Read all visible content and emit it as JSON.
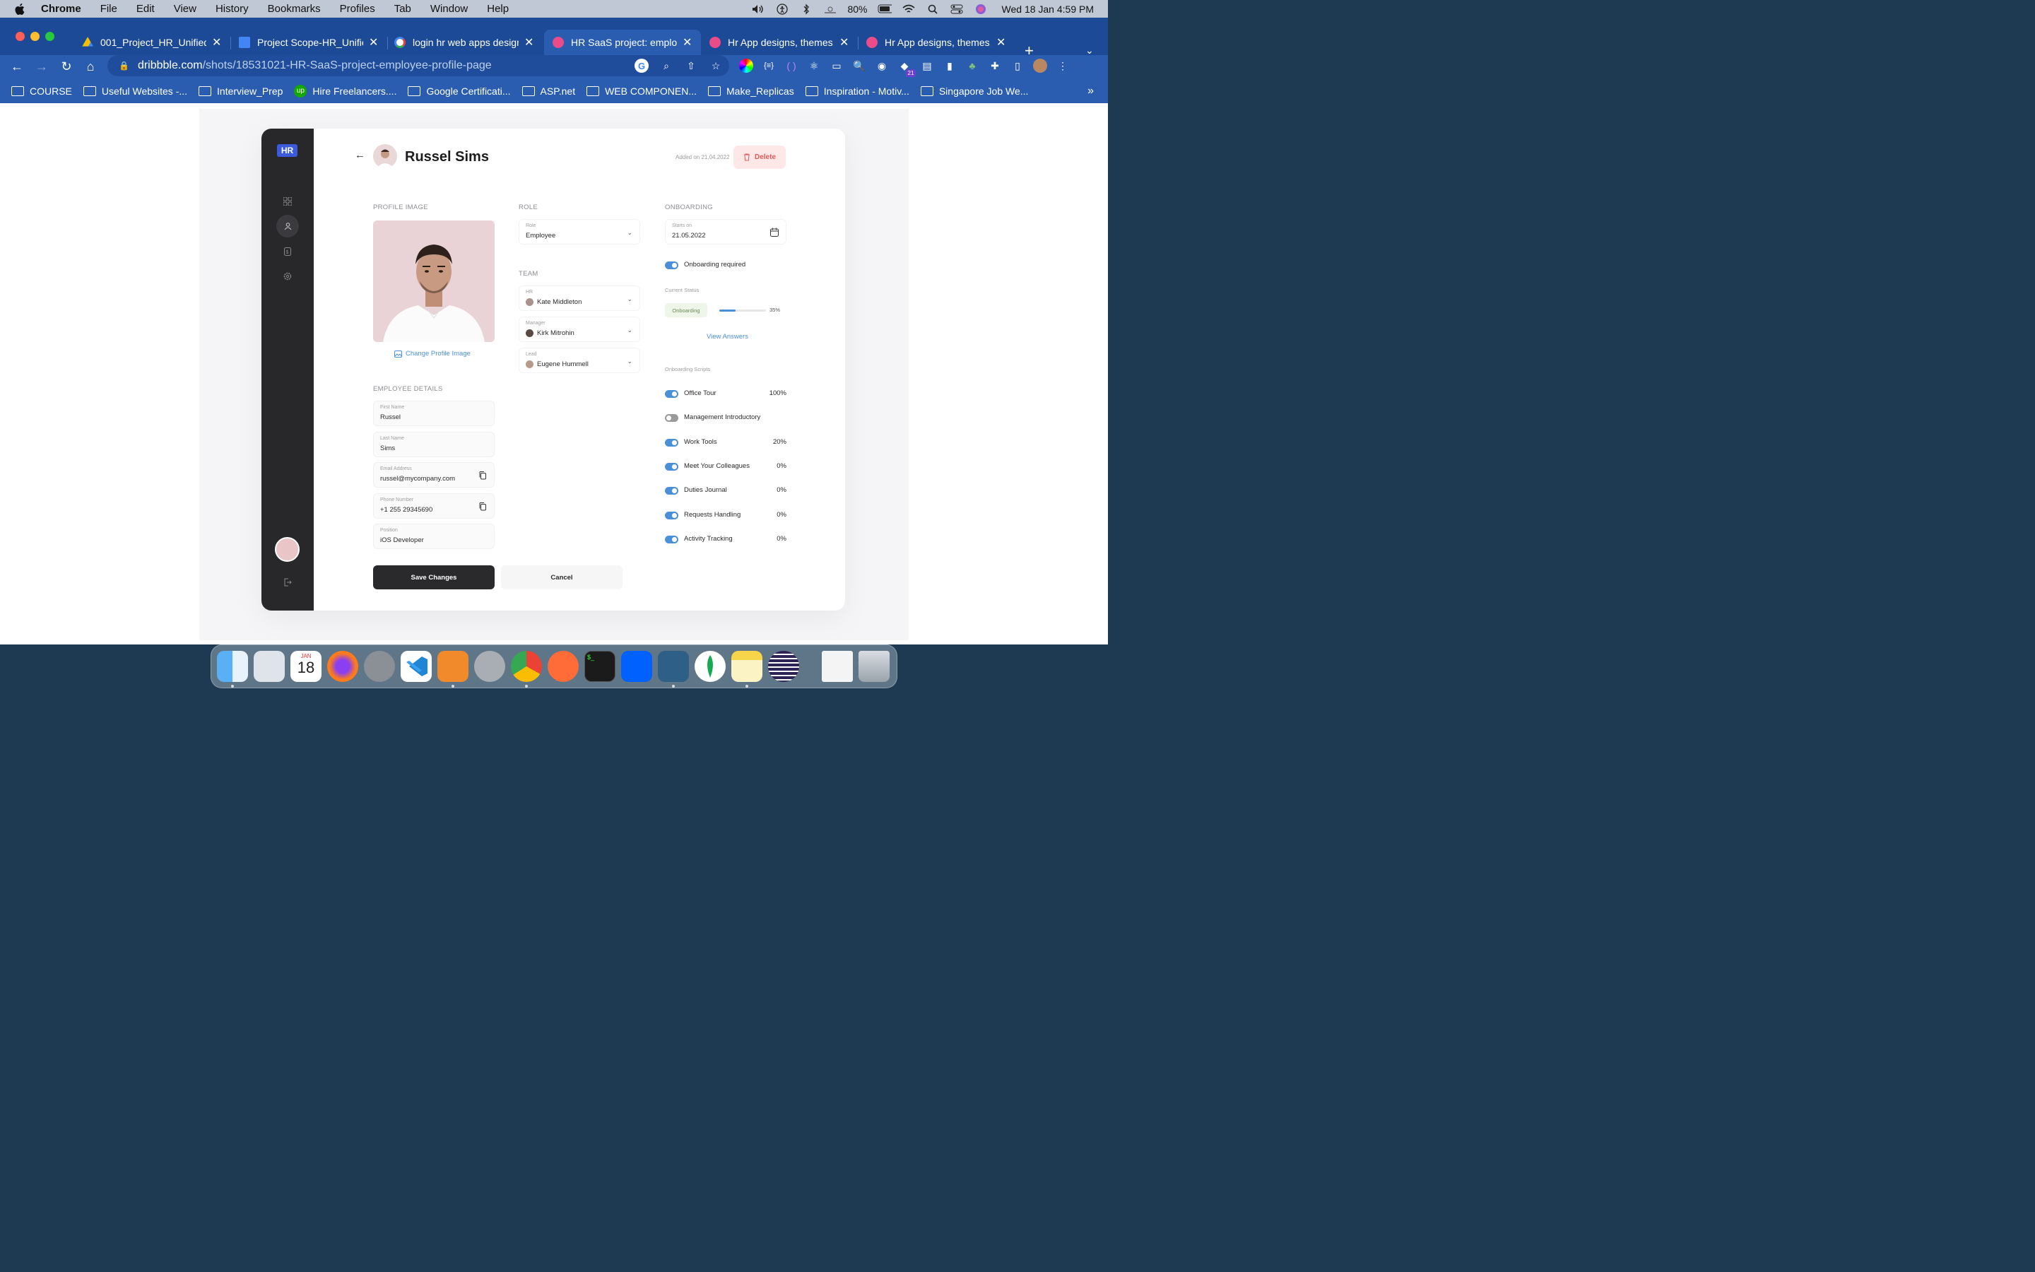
{
  "menubar": {
    "app": "Chrome",
    "items": [
      "File",
      "Edit",
      "View",
      "History",
      "Bookmarks",
      "Profiles",
      "Tab",
      "Window",
      "Help"
    ],
    "battery": "80%",
    "datetime": "Wed 18 Jan  4:59 PM"
  },
  "tabs": [
    {
      "title": "001_Project_HR_Unified",
      "icon": "google-drive-icon",
      "color": "#fbbc04"
    },
    {
      "title": "Project Scope-HR_Unifie",
      "icon": "docs-icon",
      "color": "#4285f4"
    },
    {
      "title": "login hr web apps design",
      "icon": "google-icon",
      "color": "#ffffff"
    },
    {
      "title": "HR SaaS project: employ",
      "icon": "dribbble-icon",
      "color": "#ea4c89"
    },
    {
      "title": "Hr App designs, themes,",
      "icon": "dribbble-icon",
      "color": "#ea4c89"
    },
    {
      "title": "Hr App designs, themes,",
      "icon": "dribbble-icon",
      "color": "#ea4c89"
    }
  ],
  "address": {
    "domain": "dribbble.com",
    "path": "/shots/18531021-HR-SaaS-project-employee-profile-page"
  },
  "extension_badge": "21",
  "bookmarks": [
    "COURSE",
    "Useful Websites -...",
    "Interview_Prep",
    "Hire Freelancers....",
    "Google Certificati...",
    "ASP.net",
    "WEB COMPONEN...",
    "Make_Replicas",
    "Inspiration - Motiv...",
    "Singapore Job We..."
  ],
  "app": {
    "logo": "HR",
    "header": {
      "name": "Russel Sims",
      "added": "Added on 21.04.2022",
      "delete_label": "Delete"
    },
    "profile_image_heading": "PROFILE IMAGE",
    "change_image_label": "Change Profile Image",
    "employee_details_heading": "EMPLOYEE DETAILS",
    "details": [
      {
        "label": "First Name",
        "value": "Russel"
      },
      {
        "label": "Last Name",
        "value": "Sims"
      },
      {
        "label": "Email Address",
        "value": "russel@mycompany.com"
      },
      {
        "label": "Phone Number",
        "value": "+1 255 29345690"
      },
      {
        "label": "Position",
        "value": "iOS Developer"
      }
    ],
    "role_heading": "ROLE",
    "role": {
      "label": "Role",
      "value": "Employee"
    },
    "team_heading": "TEAM",
    "team": [
      {
        "label": "HR",
        "value": "Kate Middleton"
      },
      {
        "label": "Manager",
        "value": "Kirk Mitrohin"
      },
      {
        "label": "Lead",
        "value": "Eugene Hummell"
      }
    ],
    "onboarding_heading": "ONBOARDING",
    "starts": {
      "label": "Starts on",
      "value": "21.05.2022"
    },
    "onboarding_required": "Onboarding required",
    "current_status_label": "Current Status",
    "status_badge": "Onboarding",
    "status_progress": 0.35,
    "status_percent": "35%",
    "view_answers": "View Answers",
    "scripts_label": "Onboarding Scripts",
    "scripts": [
      {
        "name": "Office Tour",
        "on": true,
        "percent": "100%"
      },
      {
        "name": "Management Introductory",
        "on": false,
        "percent": ""
      },
      {
        "name": "Work Tools",
        "on": true,
        "percent": "20%"
      },
      {
        "name": "Meet Your Colleagues",
        "on": true,
        "percent": "0%"
      },
      {
        "name": "Duties Journal",
        "on": true,
        "percent": "0%"
      },
      {
        "name": "Requests Handling",
        "on": true,
        "percent": "0%"
      },
      {
        "name": "Activity Tracking",
        "on": true,
        "percent": "0%"
      }
    ],
    "save_label": "Save Changes",
    "cancel_label": "Cancel"
  },
  "dock": {
    "calendar_month": "JAN",
    "calendar_day": "18"
  }
}
